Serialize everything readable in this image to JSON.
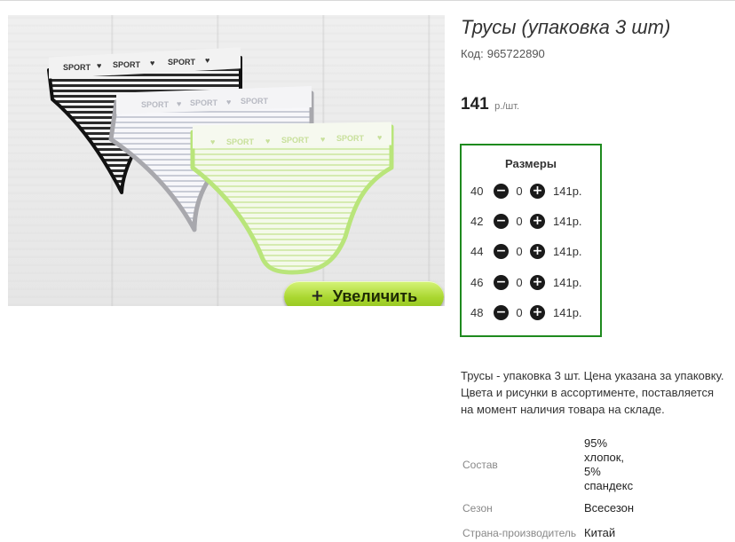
{
  "product": {
    "title": "Трусы (упаковка 3 шт)",
    "code_label": "Код:",
    "code": "965722890",
    "price": "141",
    "price_unit": "р./шт."
  },
  "photo": {
    "zoom_plus": "+",
    "zoom_label": "Увеличить",
    "waistband_text": "SPORT"
  },
  "sizes": {
    "title": "Размеры",
    "minus_icon": "−",
    "plus_icon": "+",
    "rows": [
      {
        "size": "40",
        "qty": "0",
        "price": "141р."
      },
      {
        "size": "42",
        "qty": "0",
        "price": "141р."
      },
      {
        "size": "44",
        "qty": "0",
        "price": "141р."
      },
      {
        "size": "46",
        "qty": "0",
        "price": "141р."
      },
      {
        "size": "48",
        "qty": "0",
        "price": "141р."
      }
    ]
  },
  "description": {
    "line1": "Трусы - упаковка 3 шт. Цена указана за упаковку.",
    "line2": "Цвета и рисунки в ассортименте, поставляется",
    "line3": "на момент наличия товара на складе."
  },
  "attributes": {
    "composition_label": "Состав",
    "composition_lines": [
      "95%",
      "хлопок,",
      "5%",
      "спандекс"
    ],
    "season_label": "Сезон",
    "season_value": "Всесезон",
    "country_label": "Страна-производитель",
    "country_value": "Китай"
  },
  "colors": {
    "accent_green": "#1e8a1e",
    "zoom_button": "#a9d62f"
  }
}
